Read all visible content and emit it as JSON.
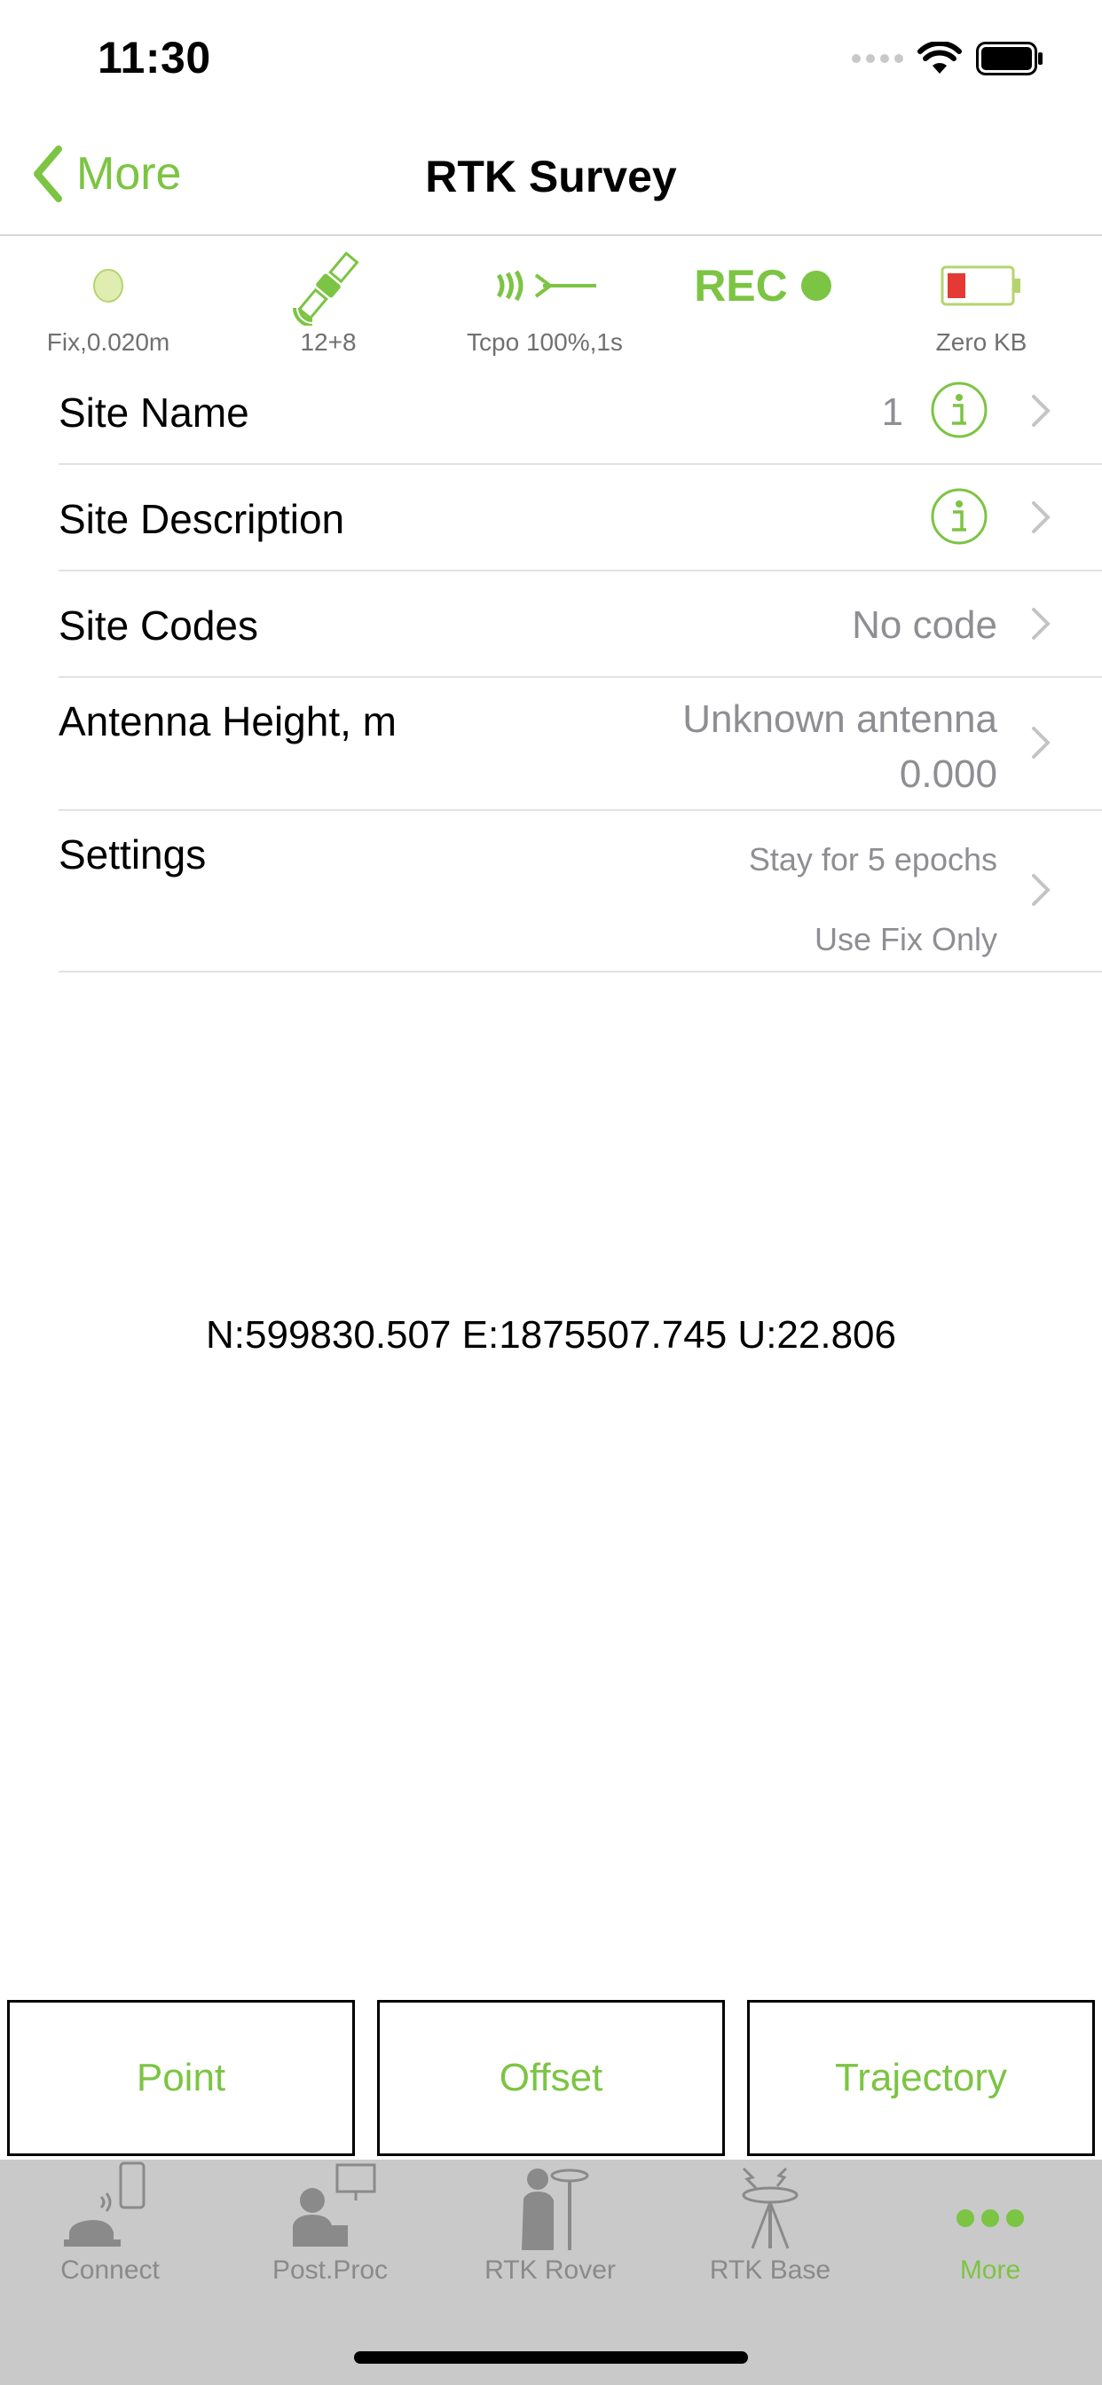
{
  "status_bar": {
    "time": "11:30"
  },
  "nav": {
    "back_label": "More",
    "title": "RTK Survey"
  },
  "indicators": {
    "fix": "Fix,0.020m",
    "satellites": "12+8",
    "correction": "Tcpo 100%,1s",
    "rec_label": "REC",
    "memory": "Zero KB"
  },
  "rows": {
    "site_name": {
      "title": "Site Name",
      "value": "1"
    },
    "site_description": {
      "title": "Site Description"
    },
    "site_codes": {
      "title": "Site Codes",
      "value": "No code"
    },
    "antenna_height": {
      "title": "Antenna Height, m",
      "value_line1": "Unknown antenna",
      "value_line2": "0.000"
    },
    "settings": {
      "title": "Settings",
      "value_line1": "Stay for 5 epochs",
      "value_line2": "Use Fix Only"
    }
  },
  "coordinates": "N:599830.507 E:1875507.745 U:22.806",
  "actions": {
    "point": "Point",
    "offset": "Offset",
    "trajectory": "Trajectory"
  },
  "tabs": [
    {
      "label": "Connect",
      "icon": "connect-icon"
    },
    {
      "label": "Post.Proc",
      "icon": "post-proc-icon"
    },
    {
      "label": "RTK Rover",
      "icon": "rtk-rover-icon"
    },
    {
      "label": "RTK Base",
      "icon": "rtk-base-icon"
    },
    {
      "label": "More",
      "icon": "more-dots-icon"
    }
  ],
  "colors": {
    "accent": "#7cc443",
    "battery_low": "#e53935",
    "tab_bar": "#c9c9c9"
  }
}
